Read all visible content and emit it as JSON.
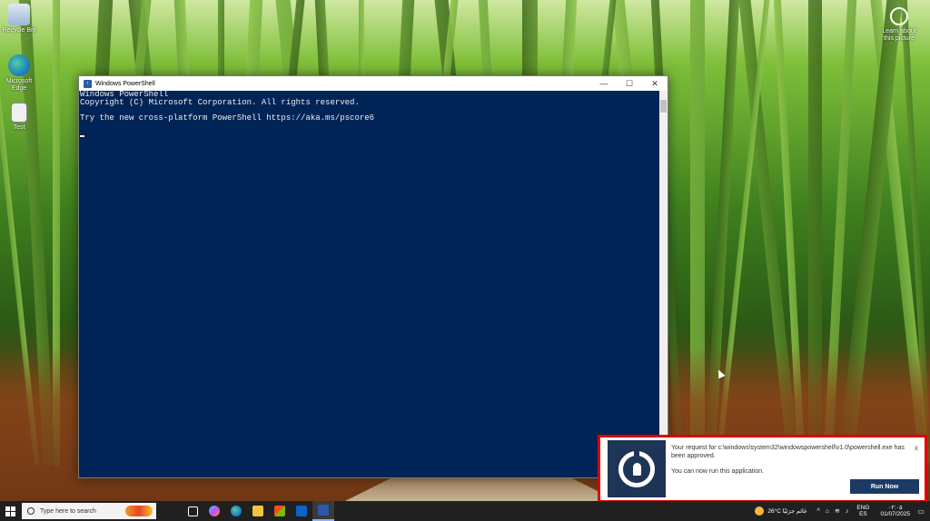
{
  "desktop": {
    "icons": [
      {
        "label": "Recycle Bin",
        "name": "recycle-bin-icon"
      },
      {
        "label": "Microsoft Edge",
        "name": "edge-icon"
      },
      {
        "label": "Test",
        "name": "test-file-icon"
      }
    ],
    "learn_label": "Learn about this picture"
  },
  "powershell": {
    "title": "Windows PowerShell",
    "lines": [
      "Windows PowerShell",
      "Copyright (C) Microsoft Corporation. All rights reserved.",
      "",
      "Try the new cross-platform PowerShell https://aka.ms/pscore6"
    ],
    "bg_color": "#012456"
  },
  "toast": {
    "message": "Your request for c:\\windows\\system32\\windowspowershell\\v1.0\\powershell.exe has been approved.",
    "sub_message": "You can now run this application.",
    "run_label": "Run Now",
    "close_label": "x",
    "accent_color": "#1c3a66"
  },
  "taskbar": {
    "search_placeholder": "Type here to search",
    "pinned": [
      "task-view-icon",
      "copilot-icon",
      "edge-icon",
      "file-explorer-icon",
      "store-icon",
      "outlook-icon",
      "powershell-icon"
    ],
    "weather_temp": "26°C",
    "weather_text": "غائم جزئيًا",
    "lang_top": "ENG",
    "lang_bottom": "ES",
    "time": "٠٢:٠٥",
    "date": "01/07/2025"
  }
}
